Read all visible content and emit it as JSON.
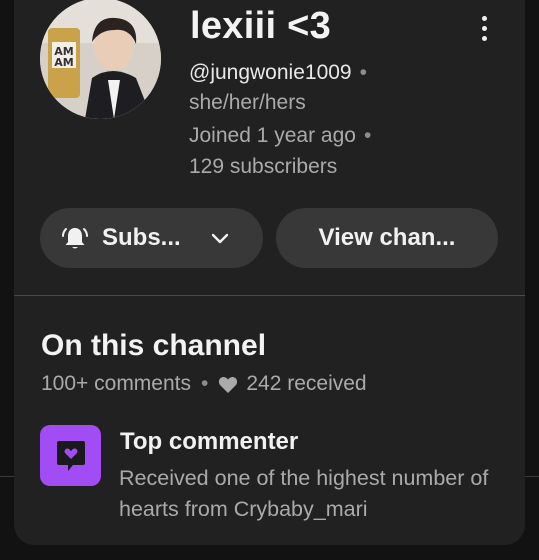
{
  "channel": {
    "name": "lexiii <3",
    "handle": "@jungwonie1009",
    "pronouns": "she/her/hers",
    "joined": "Joined 1 year ago",
    "subscribers": "129 subscribers",
    "separator": "•"
  },
  "actions": {
    "subscribe_label": "Subs...",
    "view_channel_label": "View chan..."
  },
  "on_channel": {
    "title": "On this channel",
    "comments": "100+ comments",
    "separator": "•",
    "hearts_received": "242 received"
  },
  "badge": {
    "title": "Top commenter",
    "description": "Received one of the highest number of hearts from Crybaby_mari"
  },
  "colors": {
    "background": "#121212",
    "card": "#212121",
    "pill": "#383838",
    "badge": "#a24cf5",
    "secondary_text": "#aaaaaa"
  },
  "icons": {
    "more": "more-vert-icon",
    "bell": "notification-bell-icon",
    "chevron": "chevron-down-icon",
    "heart": "heart-icon",
    "badge": "chat-heart-icon"
  }
}
